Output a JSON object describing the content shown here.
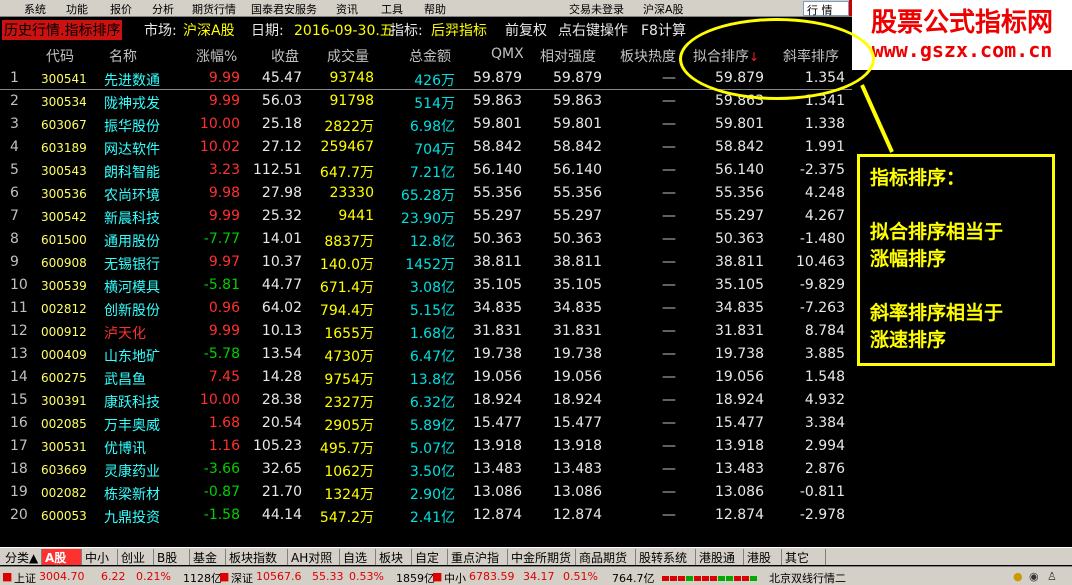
{
  "menu": {
    "items": [
      "系统",
      "功能",
      "报价",
      "分析",
      "期货行情",
      "国泰君安服务",
      "资讯",
      "工具",
      "帮助"
    ],
    "right_items": [
      "交易未登录",
      "沪深A股"
    ],
    "trade_box": "行 情"
  },
  "titlebar": {
    "history": "历史行情.指标排序",
    "market_label": "市场:",
    "market_value": "沪深A股",
    "date_label": "日期:",
    "date_value": "2016-09-30.五",
    "indicator_label": "指标:",
    "indicator_value": "后羿指标",
    "adjust": "前复权",
    "hint": "点右键操作",
    "f8": "F8计算"
  },
  "table": {
    "columns": [
      "代码",
      "名称",
      "涨幅%",
      "收盘",
      "成交量",
      "总金额",
      "QMX",
      "相对强度",
      "板块热度",
      "拟合排序",
      "斜率排序"
    ],
    "sort_arrow": "↓",
    "rows": [
      {
        "idx": "1",
        "code": "300541",
        "name": "先进数通",
        "pct": "9.99",
        "dir": "up",
        "price": "45.47",
        "vol": "93748",
        "amt": "426万",
        "qmx": "59.879",
        "rs": "59.879",
        "heat": "—",
        "fit": "59.879",
        "slope": "1.354"
      },
      {
        "idx": "2",
        "code": "300534",
        "name": "陇神戎发",
        "pct": "9.99",
        "dir": "up",
        "price": "56.03",
        "vol": "91798",
        "amt": "514万",
        "qmx": "59.863",
        "rs": "59.863",
        "heat": "—",
        "fit": "59.863",
        "slope": "1.341"
      },
      {
        "idx": "3",
        "code": "603067",
        "name": "振华股份",
        "pct": "10.00",
        "dir": "up",
        "price": "25.18",
        "vol": "2822万",
        "amt": "6.98亿",
        "qmx": "59.801",
        "rs": "59.801",
        "heat": "—",
        "fit": "59.801",
        "slope": "1.338"
      },
      {
        "idx": "4",
        "code": "603189",
        "name": "网达软件",
        "pct": "10.02",
        "dir": "up",
        "price": "27.12",
        "vol": "259467",
        "amt": "704万",
        "qmx": "58.842",
        "rs": "58.842",
        "heat": "—",
        "fit": "58.842",
        "slope": "1.991"
      },
      {
        "idx": "5",
        "code": "300543",
        "name": "朗科智能",
        "pct": "3.23",
        "dir": "up",
        "price": "112.51",
        "vol": "647.7万",
        "amt": "7.21亿",
        "qmx": "56.140",
        "rs": "56.140",
        "heat": "—",
        "fit": "56.140",
        "slope": "-2.375"
      },
      {
        "idx": "6",
        "code": "300536",
        "name": "农尚环境",
        "pct": "9.98",
        "dir": "up",
        "price": "27.98",
        "vol": "23330",
        "amt": "65.28万",
        "qmx": "55.356",
        "rs": "55.356",
        "heat": "—",
        "fit": "55.356",
        "slope": "4.248"
      },
      {
        "idx": "7",
        "code": "300542",
        "name": "新晨科技",
        "pct": "9.99",
        "dir": "up",
        "price": "25.32",
        "vol": "9441",
        "amt": "23.90万",
        "qmx": "55.297",
        "rs": "55.297",
        "heat": "—",
        "fit": "55.297",
        "slope": "4.267"
      },
      {
        "idx": "8",
        "code": "601500",
        "name": "通用股份",
        "pct": "-7.77",
        "dir": "down",
        "price": "14.01",
        "vol": "8837万",
        "amt": "12.8亿",
        "qmx": "50.363",
        "rs": "50.363",
        "heat": "—",
        "fit": "50.363",
        "slope": "-1.480"
      },
      {
        "idx": "9",
        "code": "600908",
        "name": "无锡银行",
        "pct": "9.97",
        "dir": "up",
        "price": "10.37",
        "vol": "140.0万",
        "amt": "1452万",
        "qmx": "38.811",
        "rs": "38.811",
        "heat": "—",
        "fit": "38.811",
        "slope": "10.463"
      },
      {
        "idx": "10",
        "code": "300539",
        "name": "横河模具",
        "pct": "-5.81",
        "dir": "down",
        "price": "44.77",
        "vol": "671.4万",
        "amt": "3.08亿",
        "qmx": "35.105",
        "rs": "35.105",
        "heat": "—",
        "fit": "35.105",
        "slope": "-9.829"
      },
      {
        "idx": "11",
        "code": "002812",
        "name": "创新股份",
        "pct": "0.96",
        "dir": "up",
        "price": "64.02",
        "vol": "794.4万",
        "amt": "5.15亿",
        "qmx": "34.835",
        "rs": "34.835",
        "heat": "—",
        "fit": "34.835",
        "slope": "-7.263"
      },
      {
        "idx": "12",
        "code": "000912",
        "name": "泸天化",
        "pct": "9.99",
        "dir": "up",
        "price": "10.13",
        "vol": "1655万",
        "amt": "1.68亿",
        "qmx": "31.831",
        "rs": "31.831",
        "heat": "—",
        "fit": "31.831",
        "slope": "8.784"
      },
      {
        "idx": "13",
        "code": "000409",
        "name": "山东地矿",
        "pct": "-5.78",
        "dir": "down",
        "price": "13.54",
        "vol": "4730万",
        "amt": "6.47亿",
        "qmx": "19.738",
        "rs": "19.738",
        "heat": "—",
        "fit": "19.738",
        "slope": "3.885"
      },
      {
        "idx": "14",
        "code": "600275",
        "name": "武昌鱼",
        "pct": "7.45",
        "dir": "up",
        "price": "14.28",
        "vol": "9754万",
        "amt": "13.8亿",
        "qmx": "19.056",
        "rs": "19.056",
        "heat": "—",
        "fit": "19.056",
        "slope": "1.548"
      },
      {
        "idx": "15",
        "code": "300391",
        "name": "康跃科技",
        "pct": "10.00",
        "dir": "up",
        "price": "28.38",
        "vol": "2327万",
        "amt": "6.32亿",
        "qmx": "18.924",
        "rs": "18.924",
        "heat": "—",
        "fit": "18.924",
        "slope": "4.932"
      },
      {
        "idx": "16",
        "code": "002085",
        "name": "万丰奥威",
        "pct": "1.68",
        "dir": "up",
        "price": "20.54",
        "vol": "2905万",
        "amt": "5.89亿",
        "qmx": "15.477",
        "rs": "15.477",
        "heat": "—",
        "fit": "15.477",
        "slope": "3.384"
      },
      {
        "idx": "17",
        "code": "300531",
        "name": "优博讯",
        "pct": "1.16",
        "dir": "up",
        "price": "105.23",
        "vol": "495.7万",
        "amt": "5.07亿",
        "qmx": "13.918",
        "rs": "13.918",
        "heat": "—",
        "fit": "13.918",
        "slope": "2.994"
      },
      {
        "idx": "18",
        "code": "603669",
        "name": "灵康药业",
        "pct": "-3.66",
        "dir": "down",
        "price": "32.65",
        "vol": "1062万",
        "amt": "3.50亿",
        "qmx": "13.483",
        "rs": "13.483",
        "heat": "—",
        "fit": "13.483",
        "slope": "2.876"
      },
      {
        "idx": "19",
        "code": "002082",
        "name": "栋梁新材",
        "pct": "-0.87",
        "dir": "down",
        "price": "21.70",
        "vol": "1324万",
        "amt": "2.90亿",
        "qmx": "13.086",
        "rs": "13.086",
        "heat": "—",
        "fit": "13.086",
        "slope": "-0.811"
      },
      {
        "idx": "20",
        "code": "600053",
        "name": "九鼎投资",
        "pct": "-1.58",
        "dir": "down",
        "price": "44.14",
        "vol": "547.2万",
        "amt": "2.41亿",
        "qmx": "12.874",
        "rs": "12.874",
        "heat": "—",
        "fit": "12.874",
        "slope": "-2.978"
      }
    ]
  },
  "note": {
    "title": "指标排序：",
    "line1a": "拟合排序相当于",
    "line1b": "涨幅排序",
    "line2a": "斜率排序相当于",
    "line2b": "涨速排序"
  },
  "watermark": {
    "title": "股票公式指标网",
    "url": "www.gszx.com.cn"
  },
  "tabs": [
    "分类▲",
    "A股",
    "中小",
    "创业",
    "B股",
    "基金",
    "板块指数",
    "AH对照",
    "自选",
    "板块",
    "自定",
    "重点沪指",
    "中金所期货",
    "商品期货",
    "股转系统",
    "港股通",
    "港股",
    "其它"
  ],
  "status": {
    "sh_label": "上证",
    "sh_value": "3004.70",
    "sh_change": "6.22",
    "sh_pct": "0.21%",
    "sh_amt": "1128亿",
    "sz_label": "深证",
    "sz_value": "10567.6",
    "sz_change": "55.33",
    "sz_pct": "0.53%",
    "sz_amt": "1859亿",
    "zx_label": "中小",
    "zx_value": "6783.59",
    "zx_change": "34.17",
    "zx_pct": "0.51%",
    "zx_amt": "764.7亿",
    "server": "北京双线行情二"
  },
  "colors": {
    "up": "#ff3030",
    "down": "#00d000",
    "code": "#ffff66",
    "name": "#33ffff",
    "annotation": "#ffff00"
  }
}
